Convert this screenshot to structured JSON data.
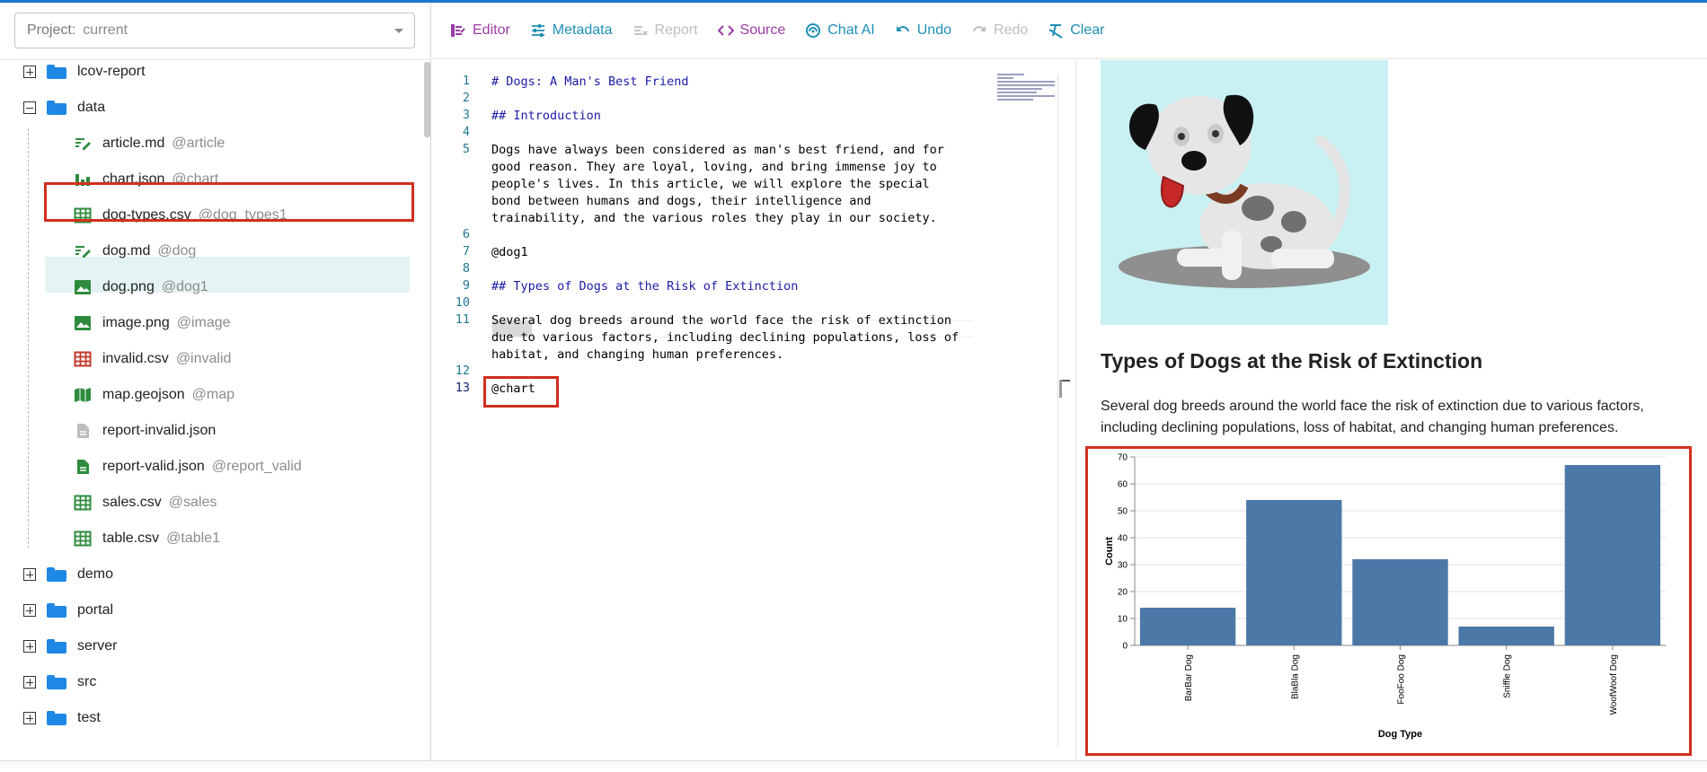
{
  "project": {
    "label": "Project:",
    "value": "current"
  },
  "tree": [
    {
      "type": "folder",
      "name": "lcov-report",
      "expanded": false
    },
    {
      "type": "folder",
      "name": "data",
      "expanded": true
    },
    {
      "type": "file",
      "icon": "markdown",
      "name": "article.md",
      "alias": "@article"
    },
    {
      "type": "file",
      "icon": "chart",
      "name": "chart.json",
      "alias": "@chart"
    },
    {
      "type": "file",
      "icon": "table",
      "name": "dog-types.csv",
      "alias": "@dog_types1"
    },
    {
      "type": "file",
      "icon": "markdown",
      "name": "dog.md",
      "alias": "@dog"
    },
    {
      "type": "file",
      "icon": "image",
      "name": "dog.png",
      "alias": "@dog1"
    },
    {
      "type": "file",
      "icon": "image",
      "name": "image.png",
      "alias": "@image"
    },
    {
      "type": "file",
      "icon": "table-invalid",
      "name": "invalid.csv",
      "alias": "@invalid"
    },
    {
      "type": "file",
      "icon": "map",
      "name": "map.geojson",
      "alias": "@map"
    },
    {
      "type": "file",
      "icon": "doc-gray",
      "name": "report-invalid.json",
      "alias": ""
    },
    {
      "type": "file",
      "icon": "doc-green",
      "name": "report-valid.json",
      "alias": "@report_valid"
    },
    {
      "type": "file",
      "icon": "table",
      "name": "sales.csv",
      "alias": "@sales"
    },
    {
      "type": "file",
      "icon": "table",
      "name": "table.csv",
      "alias": "@table1"
    },
    {
      "type": "folder",
      "name": "demo",
      "expanded": false
    },
    {
      "type": "folder",
      "name": "portal",
      "expanded": false
    },
    {
      "type": "folder",
      "name": "server",
      "expanded": false
    },
    {
      "type": "folder",
      "name": "src",
      "expanded": false
    },
    {
      "type": "folder",
      "name": "test",
      "expanded": false
    }
  ],
  "toolbar": {
    "editor": "Editor",
    "metadata": "Metadata",
    "report": "Report",
    "source": "Source",
    "chat": "Chat AI",
    "undo": "Undo",
    "redo": "Redo",
    "clear": "Clear"
  },
  "editor": {
    "lines": [
      {
        "n": "1",
        "text": "# Dogs: A Man's Best Friend",
        "kind": "heading"
      },
      {
        "n": "2",
        "text": "",
        "kind": "text"
      },
      {
        "n": "3",
        "text": "## Introduction",
        "kind": "heading"
      },
      {
        "n": "4",
        "text": "",
        "kind": "text"
      },
      {
        "n": "5",
        "text": "Dogs have always been considered as man's best friend, and for\ngood reason. They are loyal, loving, and bring immense joy to\npeople's lives. In this article, we will explore the special\nbond between humans and dogs, their intelligence and\ntrainability, and the various roles they play in our society.",
        "kind": "text"
      },
      {
        "n": "6",
        "text": "",
        "kind": "text"
      },
      {
        "n": "7",
        "text": "@dog1",
        "kind": "text"
      },
      {
        "n": "8",
        "text": "",
        "kind": "text"
      },
      {
        "n": "9",
        "text": "## Types of Dogs at the Risk of Extinction",
        "kind": "heading"
      },
      {
        "n": "10",
        "text": "",
        "kind": "text"
      },
      {
        "n": "11",
        "text": "Several dog breeds around the world face the risk of extinction\ndue to various factors, including declining populations, loss of\nhabitat, and changing human preferences.",
        "kind": "text"
      },
      {
        "n": "12",
        "text": "",
        "kind": "text"
      },
      {
        "n": "13",
        "text": "@chart",
        "kind": "text"
      }
    ]
  },
  "preview": {
    "heading": "Types of Dogs at the Risk of Extinction",
    "paragraph": "Several dog breeds around the world face the risk of extinction due to various factors, including declining populations, loss of habitat, and changing human preferences."
  },
  "colors": {
    "accent": "#1f8fb5",
    "purple": "#9c3ba6",
    "highlight": "#d12f1f",
    "bar": "#4c78a8",
    "selectedRow": "#e4f3f3"
  },
  "chart_data": {
    "type": "bar",
    "categories": [
      "BarBar Dog",
      "BlaBla Dog",
      "FooFoo Dog",
      "Sniffle Dog",
      "WoofWoof Dog"
    ],
    "values": [
      14,
      54,
      32,
      7,
      67
    ],
    "xlabel": "Dog Type",
    "ylabel": "Count",
    "ylim": [
      0,
      70
    ],
    "yticks": [
      0,
      10,
      20,
      30,
      40,
      50,
      60,
      70
    ],
    "grid": true
  }
}
